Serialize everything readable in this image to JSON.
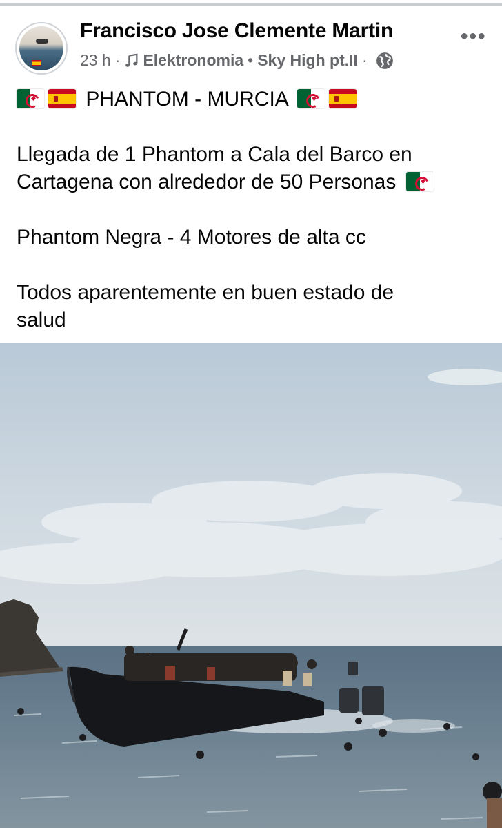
{
  "post": {
    "author": "Francisco Jose Clemente Martin",
    "time": "23 h",
    "separator": "·",
    "bullet": "•",
    "music_artist": "Elektronomia",
    "music_track": "Sky High pt.II",
    "more_label": "•••",
    "text": {
      "title": "PHANTOM - MURCIA",
      "line1": "Llegada de 1 Phantom a Cala del Barco en",
      "line2": "Cartagena con alrededor de 50 Personas",
      "line3": "Phantom Negra - 4 Motores de alta cc",
      "line4": "Todos aparentemente en buen estado de",
      "line5": "salud"
    }
  },
  "icons": {
    "music": "music-note-icon",
    "privacy": "globe-icon",
    "more": "more-options-icon",
    "flag_algeria": "algeria-flag-icon",
    "flag_spain": "spain-flag-icon"
  },
  "colors": {
    "text": "#050505",
    "secondary_text": "#65676b",
    "divider": "#c9ccd1"
  }
}
